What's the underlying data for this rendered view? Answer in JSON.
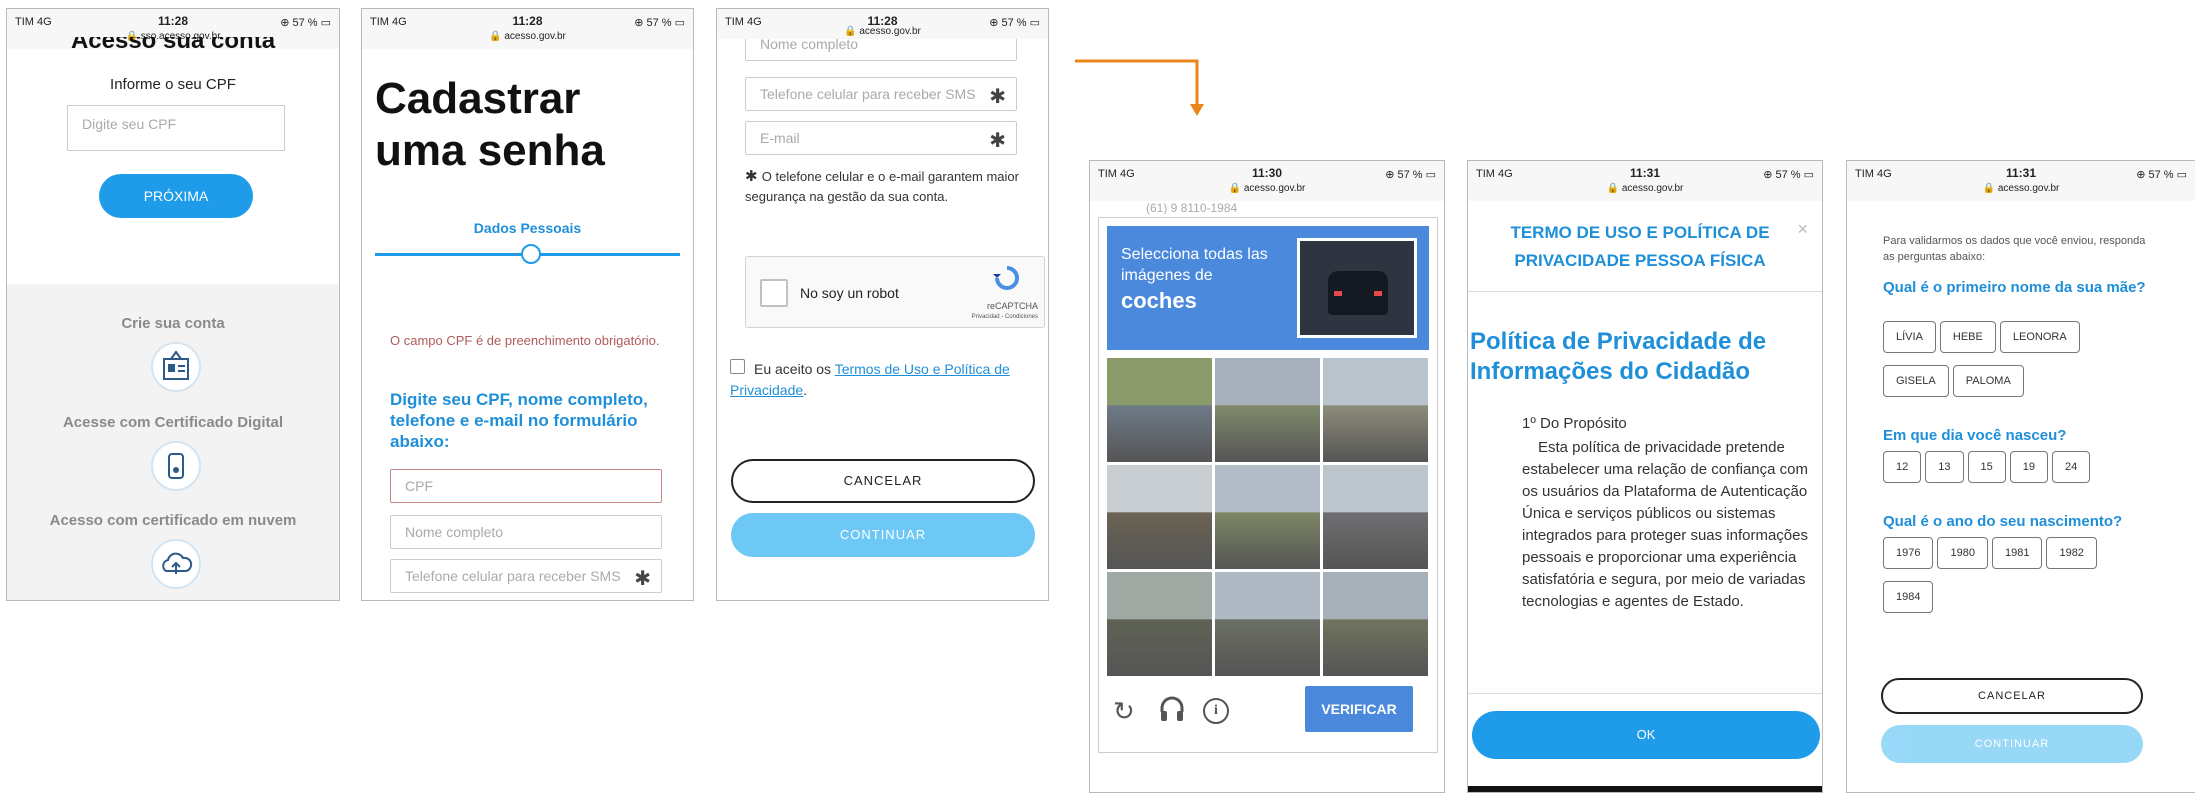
{
  "status": {
    "carrier": "TIM  4G",
    "time1": "11:28",
    "time2": "11:30",
    "time3": "11:31",
    "battery": "57 %",
    "url_sso": "sso.acesso.gov.br",
    "url": "acesso.gov.br"
  },
  "p1": {
    "cut_title": "Acesso sua conta",
    "label": "Informe o seu CPF",
    "cpf_placeholder": "Digite seu CPF",
    "next": "PRÓXIMA",
    "create": "Crie sua conta",
    "cert_digital": "Acesse com Certificado Digital",
    "cert_cloud": "Acesso com certificado em nuvem"
  },
  "p2": {
    "title_line1": "Cadastrar",
    "title_line2": "uma senha",
    "step": "Dados Pessoais",
    "error": "O campo CPF é de preenchimento obrigatório.",
    "instruction": "Digite seu CPF, nome completo, telefone e e-mail no formulário abaixo:",
    "cpf": "CPF",
    "name": "Nome completo",
    "phone": "Telefone celular para receber SMS"
  },
  "p3": {
    "name": "Nome completo",
    "phone": "Telefone celular para receber SMS",
    "email": "E-mail",
    "note": "O telefone celular e o e-mail garantem maior segurança na gestão da sua conta.",
    "robot": "No soy un robot",
    "recaptcha": "reCAPTCHA",
    "recaptcha_links": "Privacidad - Condiciones",
    "accept": "Eu aceito os ",
    "terms": "Termos de Uso e Política de Privacidade",
    "period": ".",
    "cancel": "CANCELAR",
    "continue": "CONTINUAR"
  },
  "p4": {
    "behind": "(61) 9 8110-1984",
    "prompt1": "Selecciona todas las",
    "prompt2": "imágenes de",
    "word": "coches",
    "verify": "VERIFICAR"
  },
  "p5": {
    "title": "TERMO DE USO E POLÍTICA DE PRIVACIDADE PESSOA FÍSICA",
    "close": "×",
    "heading": "Política de Privacidade de Informações do Cidadão",
    "section": "1º Do Propósito",
    "body": "Esta política de privacidade pretende estabelecer uma relação de confiança com os usuários da Plataforma de Autenticação Única e serviços públicos ou sistemas integrados para proteger suas informações pessoais e proporcionar uma experiência satisfatória e segura, por meio de variadas tecnologias e agentes de Estado.",
    "ok": "OK"
  },
  "p6": {
    "intro": "Para validarmos os dados que você enviou, responda as perguntas abaixo:",
    "q1": "Qual é o primeiro nome da sua mãe?",
    "q1_options": [
      "LÍVIA",
      "HEBE",
      "LEONORA",
      "GISELA",
      "PALOMA"
    ],
    "q2": "Em que dia você nasceu?",
    "q2_options": [
      "12",
      "13",
      "15",
      "19",
      "24"
    ],
    "q3": "Qual é o ano do seu nascimento?",
    "q3_options": [
      "1976",
      "1980",
      "1981",
      "1982",
      "1984"
    ],
    "cancel": "CANCELAR",
    "continue": "CONTINUAR"
  },
  "colors": {
    "accent": "#1e9be9",
    "arrow": "#e8861c",
    "captcha_blue": "#4a89dc",
    "question_blue": "#1e8fd8"
  }
}
